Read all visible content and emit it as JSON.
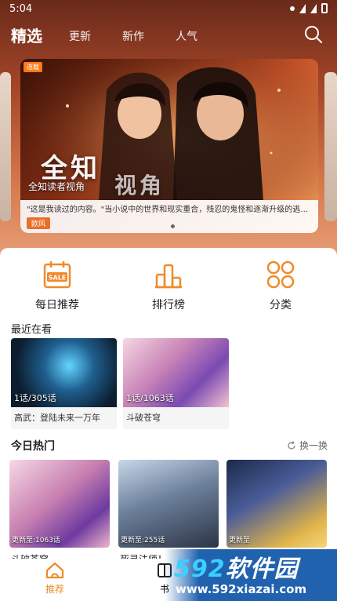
{
  "status": {
    "time": "5:04"
  },
  "topnav": {
    "main": "精选",
    "tabs": [
      "更新",
      "新作",
      "人气"
    ]
  },
  "banner": {
    "tag": "连载",
    "art_title": "全知",
    "art_title_2": "视角",
    "subtitle": "全知读者视角",
    "description": "\"这是我读过的内容。\"当小说中的世界和现实重合，残忍的鬼怪和逐渐升级的逃杀游...",
    "badge": "欧风"
  },
  "quick": [
    {
      "label": "每日推荐",
      "icon": "calendar-sale-icon"
    },
    {
      "label": "排行榜",
      "icon": "podium-icon"
    },
    {
      "label": "分类",
      "icon": "grid-icon"
    }
  ],
  "recent": {
    "title": "最近在看",
    "items": [
      {
        "progress": "1话/305话",
        "name": "高武：登陆未来一万年"
      },
      {
        "progress": "1话/1063话",
        "name": "斗破苍穹"
      }
    ]
  },
  "hot": {
    "title": "今日热门",
    "refresh": "换一换",
    "items": [
      {
        "update": "更新至:1063话",
        "name": "斗破苍穹"
      },
      {
        "update": "更新至:255话",
        "name": "死灵法师！"
      },
      {
        "update": "更新至",
        "name": ""
      }
    ]
  },
  "bottom_nav": [
    {
      "label": "推荐",
      "active": true
    },
    {
      "label": "书",
      "active": false
    }
  ],
  "watermark": {
    "brand_num": "592",
    "brand_text": "软件园",
    "url": "www.592xiazai.com"
  },
  "colors": {
    "accent": "#f08a2a",
    "hero": "#a8482a",
    "watermark": "#1f64b0"
  }
}
